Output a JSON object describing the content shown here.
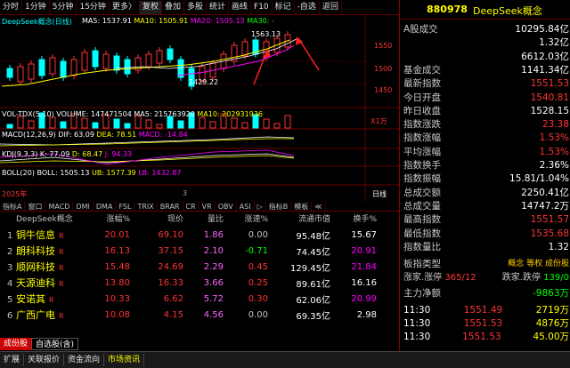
{
  "toolbar": {
    "items": [
      "分时",
      "1分钟",
      "5分钟",
      "15分钟",
      "更多〉",
      "复权",
      "叠加",
      "多股",
      "统计",
      "画线",
      "F10",
      "标记",
      "-自选",
      "返回"
    ]
  },
  "chart": {
    "title": "DeepSeek概念(日线)",
    "ma5_label": "MA5: 1537.91",
    "ma10_label": "MA10: 1505.91",
    "ma20_label": "MA20: 1505.13",
    "ma30_label": "MA30: -",
    "high_label": "1563.13",
    "low_label": "1429.22",
    "axis_ticks": [
      "1550",
      "1500",
      "1450"
    ],
    "vol_label": "VOL-TDX(5,10)",
    "vol_values": "VOLUME: 147471504  MA5: 215763920",
    "vol_ma10": "MA10: 202931936",
    "vol_unit": "X1万",
    "macd_label": "MACD(12,26,9)",
    "macd_dif": "DIF: 63.09",
    "macd_dea": "DEA: 78.51",
    "macd_val": "MACD: -14.84",
    "kdj_label": "KDJ(9,3,3)",
    "kdj_k": "K: 77.09",
    "kdj_d": "D: 68.47",
    "kdj_j": "J: 94.33",
    "boll_label": "BOLL(20)",
    "boll_boll": "BOLL: 1505.13",
    "boll_ub": "UB: 1577.39",
    "boll_lb": "LB: 1432.87",
    "year_label": "2025年",
    "date_tick": "3",
    "period": "日线"
  },
  "index_tabs": [
    "指标A",
    "窗口",
    "MACD",
    "DMI",
    "DMA",
    "FSL",
    "TRIX",
    "BRAR",
    "CR",
    "VR",
    "OBV",
    "ASI",
    "▷",
    "指标B",
    "模板",
    "≪"
  ],
  "table": {
    "headers": [
      "DeepSeek概念",
      "涨幅%",
      "现价",
      "量比",
      "涨速%",
      "流通市值",
      "换手%"
    ],
    "rows": [
      {
        "idx": "1",
        "name": "铜牛信息",
        "flag": "R",
        "chg": "20.01",
        "price": "69.10",
        "vr": "1.86",
        "spd": "0.00",
        "mv": "95.48亿",
        "to": "15.67"
      },
      {
        "idx": "2",
        "name": "朗科科技",
        "flag": "R",
        "chg": "16.13",
        "price": "37.15",
        "vr": "2.10",
        "spd": "-0.71",
        "mv": "74.45亿",
        "to": "20.91"
      },
      {
        "idx": "3",
        "name": "顺网科技",
        "flag": "R",
        "chg": "15.48",
        "price": "24.69",
        "vr": "2.29",
        "spd": "0.45",
        "mv": "129.45亿",
        "to": "21.84"
      },
      {
        "idx": "4",
        "name": "天源迪科",
        "flag": "R",
        "chg": "13.80",
        "price": "16.33",
        "vr": "3.66",
        "spd": "0.25",
        "mv": "89.61亿",
        "to": "16.16"
      },
      {
        "idx": "5",
        "name": "安诺其",
        "flag": "R",
        "chg": "10.33",
        "price": "6.62",
        "vr": "5.72",
        "spd": "0.30",
        "mv": "62.06亿",
        "to": "20.99"
      },
      {
        "idx": "6",
        "name": "广西广电",
        "flag": "R",
        "chg": "10.08",
        "price": "4.15",
        "vr": "4.56",
        "spd": "0.00",
        "mv": "69.35亿",
        "to": "2.98"
      }
    ]
  },
  "bottom_tabs": [
    "成份股",
    "自选股(含)"
  ],
  "statusbar": [
    "扩展",
    "关联报价",
    "资金流向",
    "市场资讯"
  ],
  "right": {
    "code": "880978",
    "name": "DeepSeek概念",
    "side_tabs": "资金成交",
    "rows": [
      {
        "l": "A股成交",
        "v": "10295.84亿",
        "c": "#ffffff"
      },
      {
        "l": "",
        "v": "1.32亿",
        "c": "#ffffff"
      },
      {
        "l": "",
        "v": "6612.03亿",
        "c": "#ffffff"
      },
      {
        "l": "基金成交",
        "v": "1141.34亿",
        "c": "#ffffff"
      },
      {
        "l": "最新指数",
        "v": "1551.53",
        "c": "#ff3333"
      },
      {
        "l": "今日开盘",
        "v": "1540.81",
        "c": "#ff3333"
      },
      {
        "l": "昨日收盘",
        "v": "1528.15",
        "c": "#ffffff"
      },
      {
        "l": "指数涨跌",
        "v": "23.38",
        "c": "#ff3333"
      },
      {
        "l": "指数涨幅",
        "v": "1.53%",
        "c": "#ff3333"
      },
      {
        "l": "平均涨幅",
        "v": "1.53%",
        "c": "#ff3333"
      },
      {
        "l": "指数换手",
        "v": "2.36%",
        "c": "#ffffff"
      },
      {
        "l": "指数振幅",
        "v": "15.81/1.04%",
        "c": "#ffffff"
      },
      {
        "l": "总成交额",
        "v": "2250.41亿",
        "c": "#ffffff"
      },
      {
        "l": "总成交量",
        "v": "14747.2万",
        "c": "#ffffff"
      },
      {
        "l": "最高指数",
        "v": "1551.57",
        "c": "#ff3333"
      },
      {
        "l": "最低指数",
        "v": "1535.68",
        "c": "#ff3333"
      },
      {
        "l": "指数量比",
        "v": "1.32",
        "c": "#ffffff"
      }
    ],
    "board_type_label": "板指类型",
    "board_type_value": "概念 等权 成份股",
    "updown_label": "涨家.涨停",
    "up_val": "365/12",
    "down_label": "跌家.跌停",
    "down_val": "139/0",
    "main_flow_label": "主力净额",
    "main_flow_val": "-9863万",
    "ticks": [
      {
        "t": "11:30",
        "p": "1551.49",
        "v": "2719万"
      },
      {
        "t": "11:30",
        "p": "1551.53",
        "v": "4876万"
      },
      {
        "t": "11:30",
        "p": "1551.53",
        "v": "45.00万"
      }
    ]
  }
}
